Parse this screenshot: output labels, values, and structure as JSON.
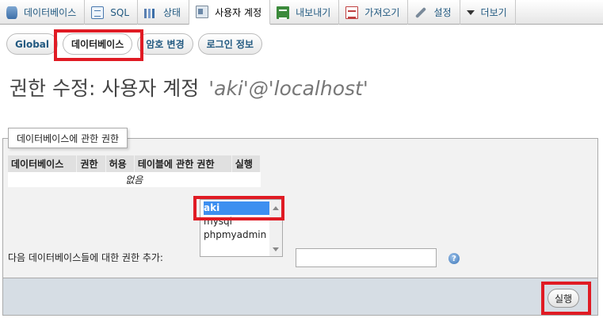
{
  "topnav": {
    "tabs": [
      {
        "label": "데이터베이스",
        "icon": "database-icon"
      },
      {
        "label": "SQL",
        "icon": "sql-icon"
      },
      {
        "label": "상태",
        "icon": "status-icon"
      },
      {
        "label": "사용자 계정",
        "icon": "users-icon",
        "active": true
      },
      {
        "label": "내보내기",
        "icon": "export-icon"
      },
      {
        "label": "가져오기",
        "icon": "import-icon"
      },
      {
        "label": "설정",
        "icon": "settings-icon"
      },
      {
        "label": "더보기",
        "icon": "caret-down-icon"
      }
    ]
  },
  "subtabs": [
    "Global",
    "데이터베이스",
    "암호 변경",
    "로그인 정보"
  ],
  "page": {
    "title": "권한 수정: 사용자 계정",
    "user": "'aki'@'localhost'"
  },
  "db_privileges": {
    "legend": "데이터베이스에 관한 권한",
    "columns": [
      "데이터베이스",
      "권한",
      "허용",
      "테이블에 관한 권한",
      "실행"
    ],
    "empty_text": "없음",
    "db_options": [
      "aki",
      "mysql",
      "phpmyadmin"
    ],
    "selected_option": "aki",
    "add_label": "다음 데이터베이스들에 대한 권한 추가:",
    "add_input_value": "",
    "help_icon": "?",
    "go_label": "실행"
  },
  "colors": {
    "highlight": "#e01b24",
    "link": "#235a81",
    "selected": "#3d8ff0"
  }
}
